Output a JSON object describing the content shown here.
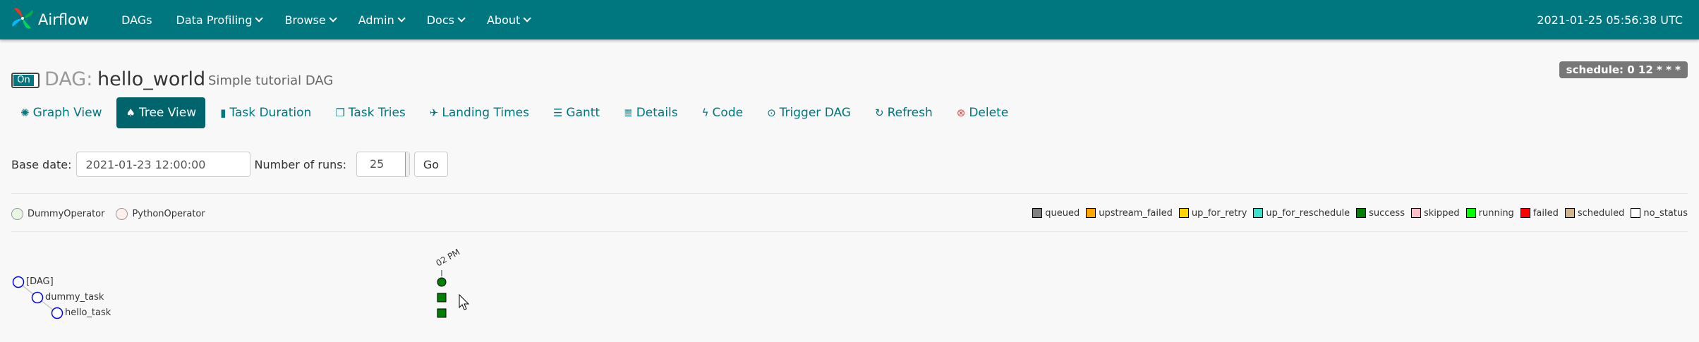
{
  "navbar": {
    "brand": "Airflow",
    "items": [
      {
        "label": "DAGs",
        "has_caret": false
      },
      {
        "label": "Data Profiling",
        "has_caret": true
      },
      {
        "label": "Browse",
        "has_caret": true
      },
      {
        "label": "Admin",
        "has_caret": true
      },
      {
        "label": "Docs",
        "has_caret": true
      },
      {
        "label": "About",
        "has_caret": true
      }
    ],
    "clock": "2021-01-25 05:56:38 UTC",
    "color": "#00767f"
  },
  "dag": {
    "toggle_label": "On",
    "prefix": "DAG:",
    "name": "hello_world",
    "description": "Simple tutorial DAG",
    "schedule": "schedule: 0 12 * * *"
  },
  "tabs": [
    {
      "label": "Graph View",
      "icon": "asterisk-icon",
      "active": false
    },
    {
      "label": "Tree View",
      "icon": "tree-icon",
      "active": true
    },
    {
      "label": "Task Duration",
      "icon": "bar-chart-icon",
      "active": false
    },
    {
      "label": "Task Tries",
      "icon": "duplicate-icon",
      "active": false
    },
    {
      "label": "Landing Times",
      "icon": "plane-icon",
      "active": false
    },
    {
      "label": "Gantt",
      "icon": "align-left-icon",
      "active": false
    },
    {
      "label": "Details",
      "icon": "list-icon",
      "active": false
    },
    {
      "label": "Code",
      "icon": "flash-icon",
      "active": false
    },
    {
      "label": "Trigger DAG",
      "icon": "play-circle-icon",
      "active": false
    },
    {
      "label": "Refresh",
      "icon": "refresh-icon",
      "active": false
    },
    {
      "label": "Delete",
      "icon": "remove-circle-icon",
      "active": false
    }
  ],
  "form": {
    "base_date_label": "Base date:",
    "base_date_value": "2021-01-23 12:00:00",
    "runs_label": "Number of runs:",
    "runs_value": "25",
    "go_label": "Go"
  },
  "operators": [
    {
      "label": "DummyOperator",
      "color": "#e8f7e4"
    },
    {
      "label": "PythonOperator",
      "color": "#ffefeb"
    }
  ],
  "states": [
    {
      "label": "queued",
      "color": "#808080"
    },
    {
      "label": "upstream_failed",
      "color": "#ffa500"
    },
    {
      "label": "up_for_retry",
      "color": "#ffd700"
    },
    {
      "label": "up_for_reschedule",
      "color": "#40e0d0"
    },
    {
      "label": "success",
      "color": "#008000"
    },
    {
      "label": "skipped",
      "color": "#ffc0cb"
    },
    {
      "label": "running",
      "color": "#00ff00"
    },
    {
      "label": "failed",
      "color": "#ff0000"
    },
    {
      "label": "scheduled",
      "color": "#d2b48c"
    },
    {
      "label": "no_status",
      "color": "#ffffff"
    }
  ],
  "tree": {
    "run_label": "02 PM",
    "nodes": [
      {
        "label": "[DAG]"
      },
      {
        "label": "dummy_task"
      },
      {
        "label": "hello_task"
      }
    ],
    "node_circle_color": "#0000ff",
    "run_state_color": "#008000"
  }
}
